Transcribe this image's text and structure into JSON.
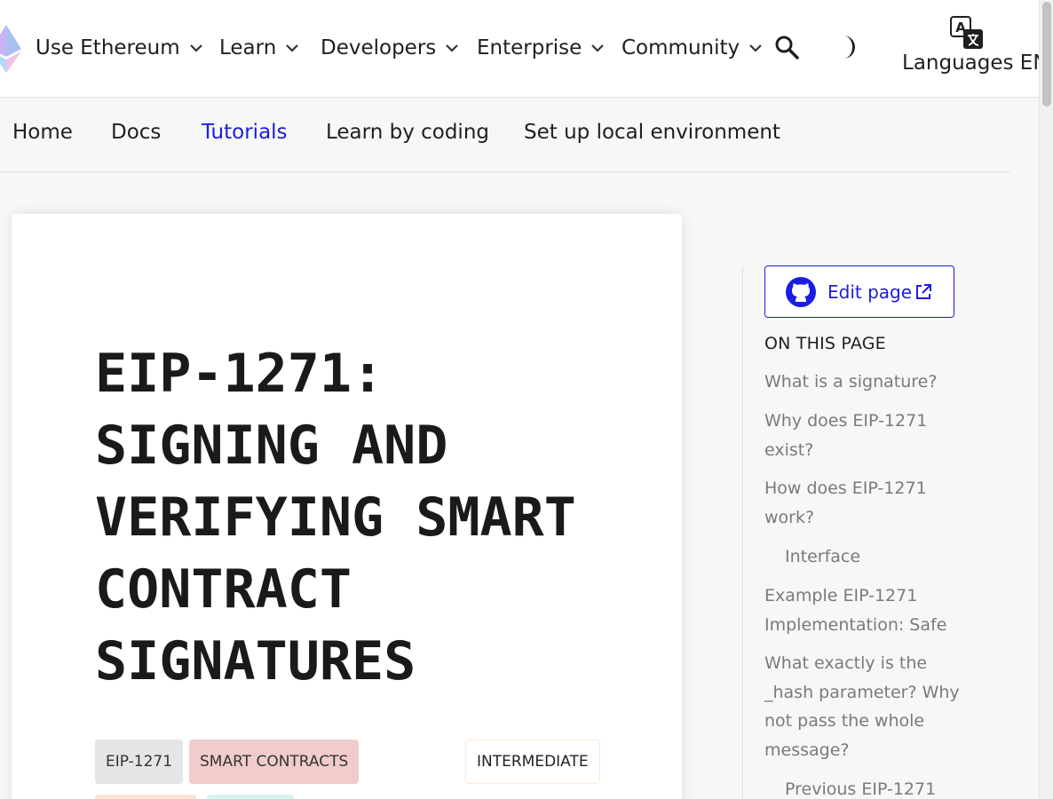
{
  "colors": {
    "accent": "#1c1ce1",
    "page_bg": "#f7f7f7",
    "card_bg": "#ffffff",
    "tag_eip": "#e5e5e5",
    "tag_smart_contracts": "#f1cccc"
  },
  "topnav": {
    "logo_icon": "ethereum-logo-icon",
    "items": [
      {
        "label": "Use Ethereum"
      },
      {
        "label": "Learn"
      },
      {
        "label": "Developers"
      },
      {
        "label": "Enterprise"
      },
      {
        "label": "Community"
      }
    ],
    "search_icon": "search-icon",
    "theme_icon": "dark-mode-moon-icon",
    "languages": {
      "label": "Languages EN",
      "icon": "translate-icon"
    }
  },
  "subnav": {
    "items": [
      {
        "label": "Home"
      },
      {
        "label": "Docs"
      },
      {
        "label": "Tutorials",
        "active": true
      },
      {
        "label": "Learn by coding"
      },
      {
        "label": "Set up local environment"
      }
    ]
  },
  "article": {
    "title": "EIP-1271: SIGNING AND VERIFYING SMART CONTRACT SIGNATURES",
    "tags": [
      {
        "label": "EIP-1271"
      },
      {
        "label": "SMART CONTRACTS"
      }
    ],
    "level": "INTERMEDIATE"
  },
  "sidebar": {
    "edit_label": "Edit page",
    "toc_heading": "ON THIS PAGE",
    "toc": [
      {
        "label": "What is a signature?"
      },
      {
        "label": "Why does EIP-1271 exist?"
      },
      {
        "label": "How does EIP-1271 work?"
      },
      {
        "label": "Interface",
        "sub": true
      },
      {
        "label": "Example EIP-1271 Implementation: Safe"
      },
      {
        "label": "What exactly is the _hash parameter? Why not pass the whole message?"
      },
      {
        "label": "Previous EIP-1271",
        "sub": true
      }
    ]
  }
}
